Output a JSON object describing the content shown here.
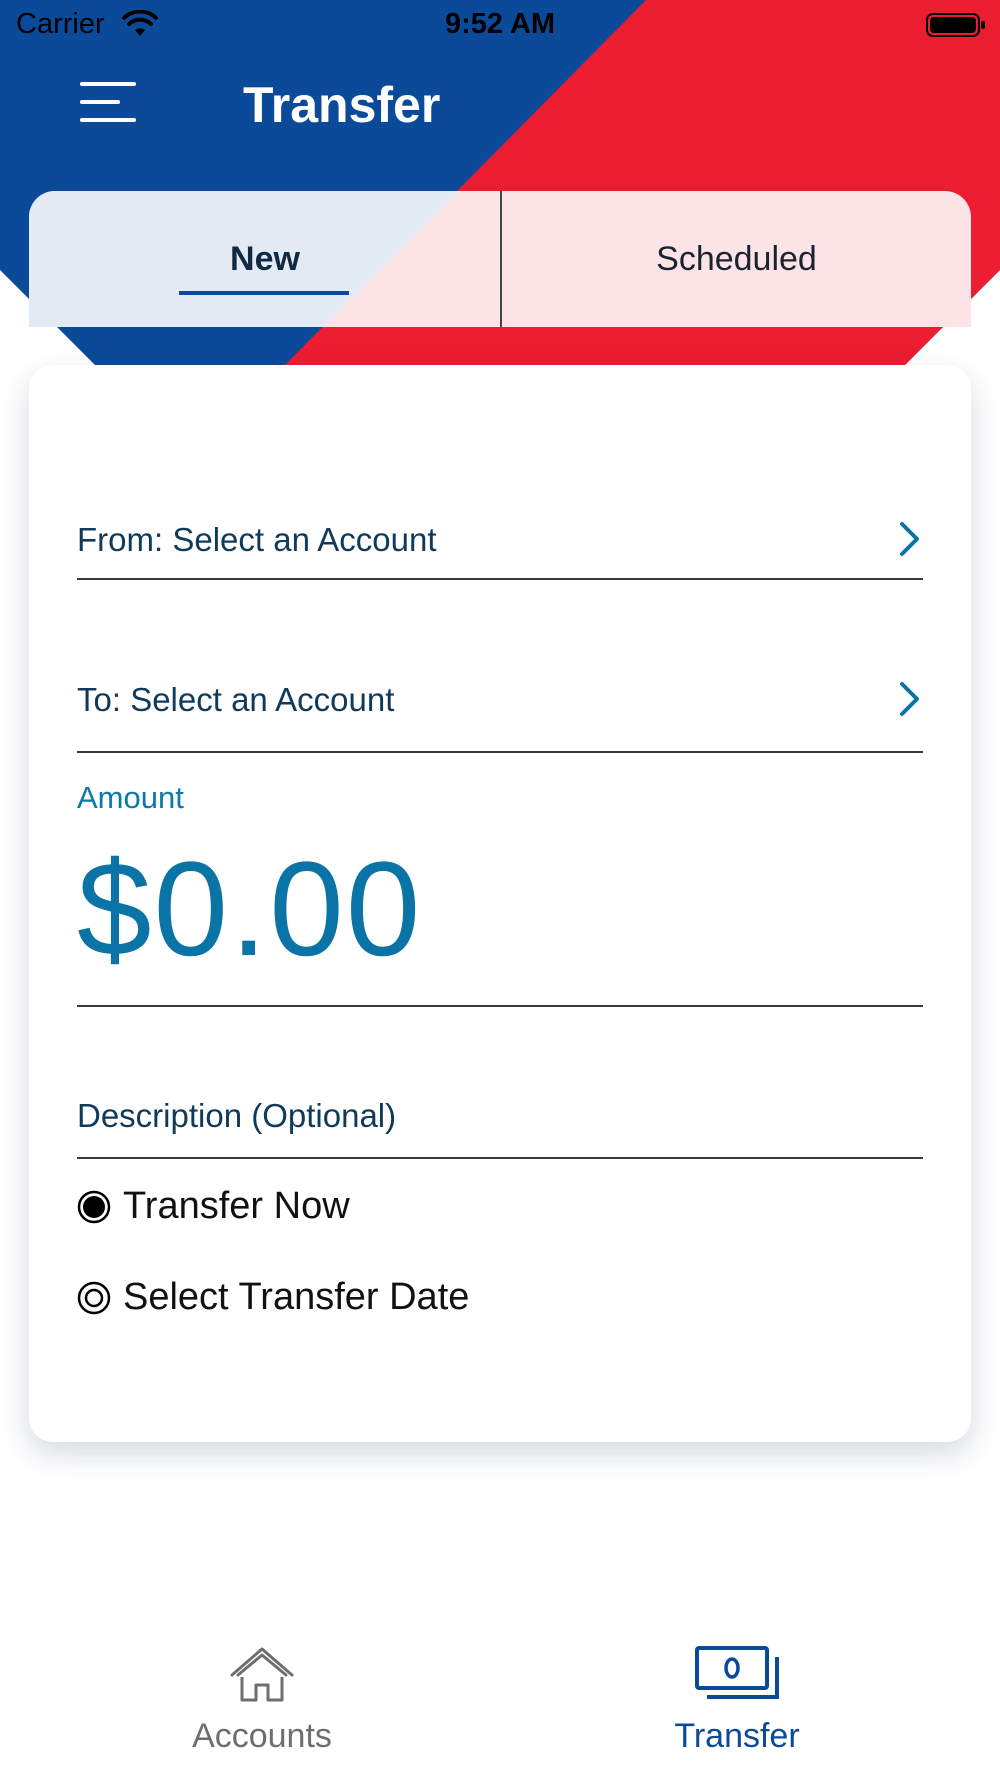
{
  "status_bar": {
    "carrier": "Carrier",
    "time": "9:52 AM"
  },
  "header": {
    "title": "Transfer",
    "menu_icon": "hamburger-menu-icon",
    "colors": {
      "blue": "#0b4a99",
      "red": "#ec1c31"
    }
  },
  "segments": {
    "new_label": "New",
    "scheduled_label": "Scheduled",
    "selected": "New"
  },
  "form": {
    "from_label": "From: Select an Account",
    "to_label": "To: Select an Account",
    "amount_label": "Amount",
    "amount_value": "$0.00",
    "description_placeholder": "Description (Optional)",
    "chevron_icon": "chevron-right-icon",
    "options": [
      {
        "label": "Transfer Now",
        "selected": true
      },
      {
        "label": "Select Transfer Date",
        "selected": false
      }
    ],
    "accent_color": "#0b74a6"
  },
  "tabbar": {
    "accounts_label": "Accounts",
    "accounts_icon": "home-icon",
    "transfer_label": "Transfer",
    "transfer_icon": "money-transfer-icon",
    "active": "Transfer"
  }
}
